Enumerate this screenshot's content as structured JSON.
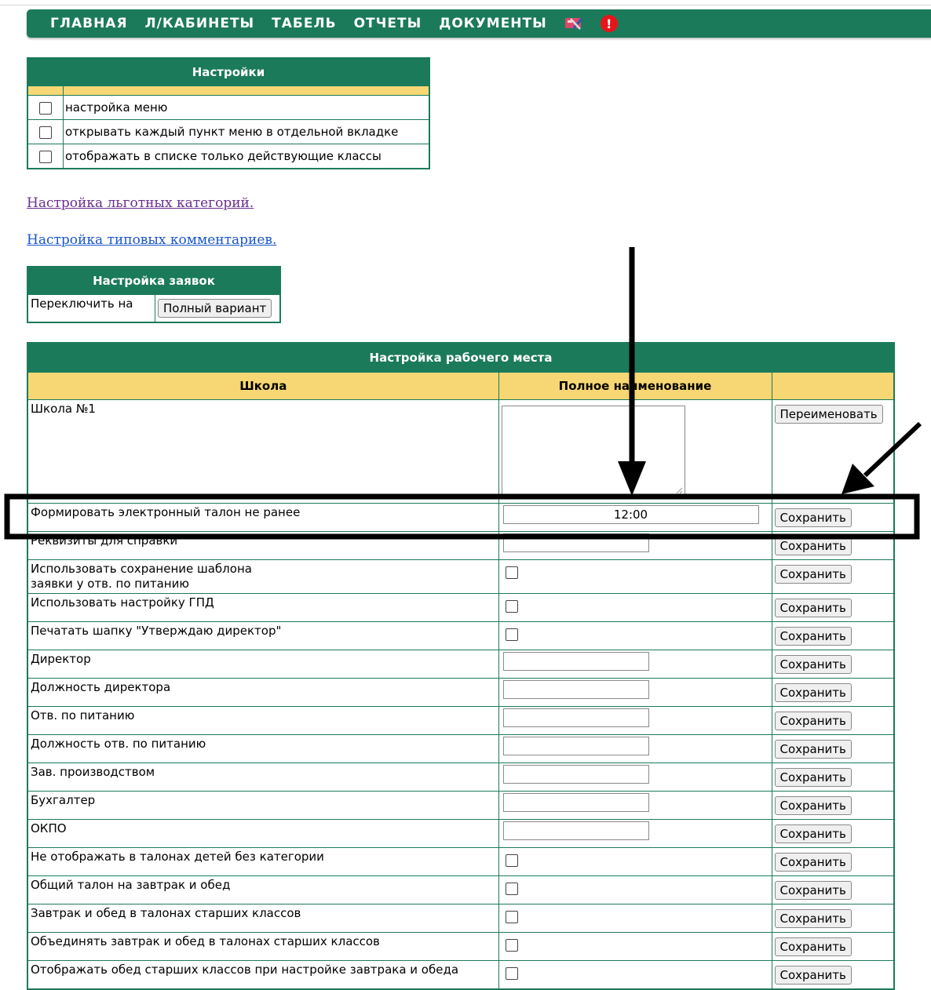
{
  "nav": {
    "items": [
      "ГЛАВНАЯ",
      "Л/КАБИНЕТЫ",
      "ТАБЕЛЬ",
      "ОТЧЕТЫ",
      "ДОКУМЕНТЫ"
    ],
    "icons": [
      "tools-icon",
      "alert-icon"
    ],
    "alert_glyph": "!"
  },
  "settings": {
    "title": "Настройки",
    "options": [
      {
        "label": "настройка меню",
        "checked": false
      },
      {
        "label": "открывать каждый пункт меню в отдельной вкладке",
        "checked": false
      },
      {
        "label": "отображать в списке только действующие классы",
        "checked": false
      }
    ]
  },
  "links": {
    "benefit_categories": "Настройка льготных категорий.",
    "typical_comments": "Настройка типовых комментариев."
  },
  "requests": {
    "title": "Настройка заявок",
    "switch_label": "Переключить на",
    "switch_button": "Полный вариант"
  },
  "workplace": {
    "title": "Настройка рабочего места",
    "col_school": "Школа",
    "col_fullname": "Полное наименование",
    "school_name": "Школа №1",
    "rename_button": "Переименовать",
    "save_label": "Сохранить",
    "rows": [
      {
        "label": "Формировать электронный талон не ранее",
        "type": "time",
        "value": "12:00"
      },
      {
        "label": "Реквизиты для справки",
        "type": "text",
        "value": ""
      },
      {
        "label": "Использовать сохранение шаблона\nзаявки у отв. по питанию",
        "type": "checkbox",
        "value": ""
      },
      {
        "label": "Использовать настройку ГПД",
        "type": "checkbox",
        "value": ""
      },
      {
        "label": "Печатать шапку \"Утверждаю директор\"",
        "type": "checkbox",
        "value": ""
      },
      {
        "label": "Директор",
        "type": "text",
        "value": ""
      },
      {
        "label": "Должность директора",
        "type": "text",
        "value": ""
      },
      {
        "label": "Отв. по питанию",
        "type": "text",
        "value": ""
      },
      {
        "label": "Должность отв. по питанию",
        "type": "text",
        "value": ""
      },
      {
        "label": "Зав. производством",
        "type": "text",
        "value": ""
      },
      {
        "label": "Бухгалтер",
        "type": "text",
        "value": ""
      },
      {
        "label": "ОКПО",
        "type": "text",
        "value": ""
      },
      {
        "label": "Не отображать в талонах детей без категории",
        "type": "checkbox",
        "value": ""
      },
      {
        "label": "Общий талон на завтрак и обед",
        "type": "checkbox",
        "value": ""
      },
      {
        "label": "Завтрак и обед в талонах старших классов",
        "type": "checkbox",
        "value": ""
      },
      {
        "label": "Объединять завтрак и обед в талонах старших классов",
        "type": "checkbox",
        "value": ""
      },
      {
        "label": "Отображать обед старших классов при настройке завтрака и обеда",
        "type": "checkbox",
        "value": ""
      }
    ]
  },
  "colors": {
    "header_green": "#1b7a5a",
    "header_yellow": "#f7d774",
    "annotation": "#000000"
  }
}
